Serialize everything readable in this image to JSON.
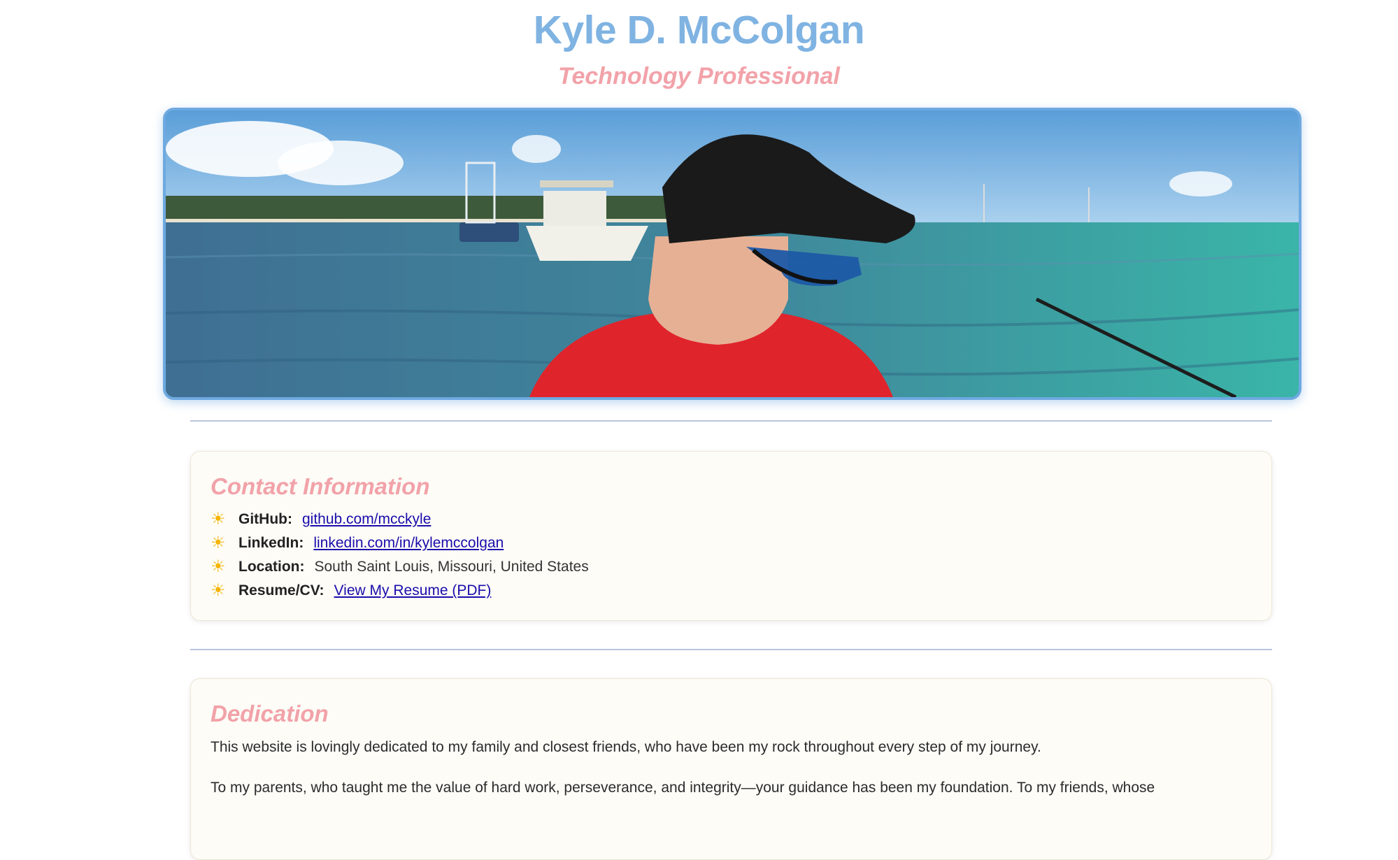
{
  "header": {
    "name": "Kyle D. McColgan",
    "tagline": "Technology Professional"
  },
  "hero": {
    "alt": "Kyle on a boat wearing a black cap, sunglasses and a red shirt, with turquoise sea and boats behind him"
  },
  "contact": {
    "title": "Contact Information",
    "items": [
      {
        "icon": "sun-icon",
        "label": "GitHub:",
        "value": "github.com/mcckyle",
        "is_link": true
      },
      {
        "icon": "sun-icon",
        "label": "LinkedIn:",
        "value": "linkedin.com/in/kylemccolgan",
        "is_link": true
      },
      {
        "icon": "sun-icon",
        "label": "Location:",
        "value": "South Saint Louis, Missouri, United States",
        "is_link": false
      },
      {
        "icon": "sun-icon",
        "label": "Resume/CV:",
        "value": "View My Resume (PDF)",
        "is_link": true
      }
    ]
  },
  "dedication": {
    "title": "Dedication",
    "paragraphs": [
      "This website is lovingly dedicated to my family and closest friends, who have been my rock throughout every step of my journey.",
      "To my parents, who taught me the value of hard work, perseverance, and integrity—your guidance has been my foundation. To my friends, whose"
    ]
  },
  "colors": {
    "name": "#7fb3e2",
    "accent": "#f2a2a9",
    "link": "#1a0dab",
    "sun": "#f4b400"
  }
}
